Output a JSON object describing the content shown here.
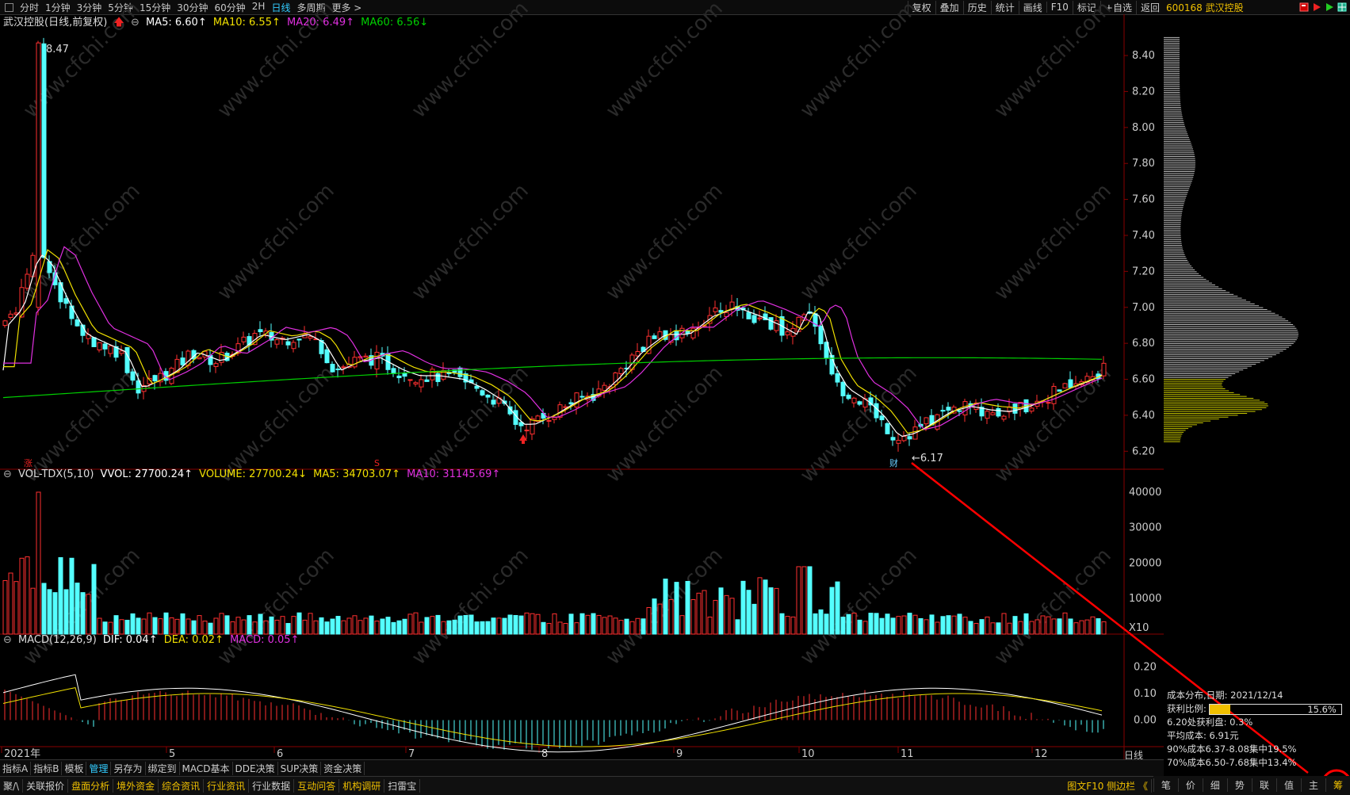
{
  "toolbar": {
    "timeframes": [
      "分时",
      "1分钟",
      "3分钟",
      "5分钟",
      "15分钟",
      "30分钟",
      "60分钟",
      "2H",
      "日线",
      "多周期",
      "更多 >"
    ],
    "active_timeframe": "日线",
    "right_buttons": [
      "复权",
      "叠加",
      "历史",
      "统计",
      "画线",
      "F10",
      "标记",
      "+自选",
      "返回"
    ]
  },
  "stock": {
    "code_name": "600168 武汉控股"
  },
  "main_legend": {
    "title": "武汉控股(日线,前复权)",
    "ma5": "MA5: 6.60↑",
    "ma10": "MA10: 6.55↑",
    "ma20": "MA20: 6.49↑",
    "ma60": "MA60: 6.56↓",
    "colors": {
      "ma5": "#ffffff",
      "ma10": "#f0e000",
      "ma20": "#e030e0",
      "ma60": "#00d000"
    }
  },
  "vol_legend": {
    "name": "VOL-TDX(5,10)",
    "vvol": "VVOL: 27700.24↑",
    "volume": "VOLUME: 27700.24↓",
    "ma5": "MA5: 34703.07↑",
    "ma10": "MA10: 31145.69↑"
  },
  "macd_legend": {
    "name": "MACD(12,26,9)",
    "dif": "DIF: 0.04↑",
    "dea": "DEA: 0.02↑",
    "macd": "MACD: 0.05↑"
  },
  "price_axis": [
    "8.40",
    "8.20",
    "8.00",
    "7.80",
    "7.60",
    "7.40",
    "7.20",
    "7.00",
    "6.80",
    "6.60",
    "6.40",
    "6.20"
  ],
  "vol_axis": [
    "40000",
    "30000",
    "20000",
    "10000",
    "X10"
  ],
  "macd_axis": [
    "0.20",
    "0.10",
    "0.00"
  ],
  "date_axis": [
    "2021年",
    "5",
    "6",
    "7",
    "8",
    "9",
    "10",
    "11",
    "12"
  ],
  "annotations": {
    "high": "8.47",
    "low": "6.17",
    "zhang": "涨",
    "s": "S",
    "cai": "财"
  },
  "watermark": "www.cfchi.com",
  "cost_panel": {
    "date_line": "成本分布,日期: 2021/12/14",
    "profit_label": "获利比例:",
    "profit_value": "15.6%",
    "profit_fraction": 0.156,
    "line1": "6.20处获利盘: 0.3%",
    "line2": "平均成本: 6.91元",
    "line3": "90%成本6.37-8.08集中19.5%",
    "line4": "70%成本6.50-7.68集中13.4%"
  },
  "period_label": "日线",
  "indicator_tabs": [
    "指标A",
    "指标B",
    "模板",
    "管理",
    "另存为",
    "绑定到",
    "MACD基本",
    "DDE决策",
    "SUP决策",
    "资金决策"
  ],
  "active_indicator_tab": "管理",
  "bottom_tabs": [
    "聚/\\",
    "关联报价",
    "盘面分析",
    "境外资金",
    "综合资讯",
    "行业资讯",
    "行业数据",
    "互动问答",
    "机构调研",
    "扫雷宝"
  ],
  "bottom_right_label": "图文F10 侧边栏 《",
  "side_tabs": [
    "笔",
    "价",
    "细",
    "势",
    "联",
    "值",
    "主",
    "筹"
  ],
  "chart_data": {
    "type": "candlestick",
    "price_range": [
      6.1,
      8.55
    ],
    "volume_range": [
      0,
      42000
    ],
    "macd_range": [
      -0.1,
      0.27
    ],
    "candles": []
  }
}
